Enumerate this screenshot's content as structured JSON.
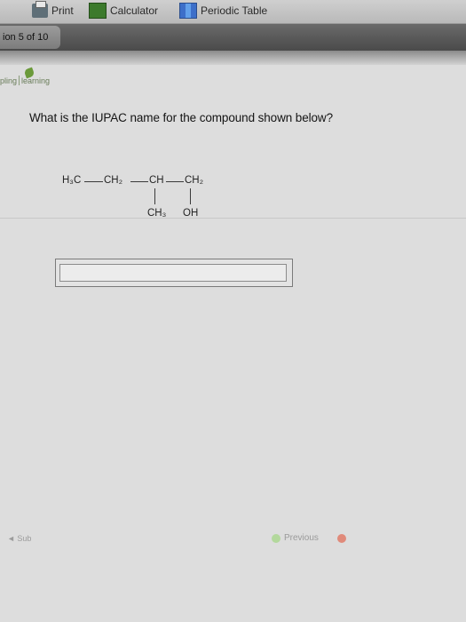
{
  "toolbar": {
    "print_label": "Print",
    "calculator_label": "Calculator",
    "periodic_table_label": "Periodic Table"
  },
  "question_counter": "ion 5 of 10",
  "brand": {
    "part1": "pling",
    "part2": "learning"
  },
  "question": {
    "prompt": "What is the IUPAC name for the compound shown below?",
    "structure": {
      "main_chain": [
        "H₃C",
        "CH₂",
        "CH",
        "CH₂"
      ],
      "substituents": [
        "CH₃",
        "OH"
      ]
    }
  },
  "answer": {
    "value": "",
    "placeholder": ""
  },
  "footer": {
    "left_text": "◄ Sub",
    "previous_label": "Previous"
  }
}
